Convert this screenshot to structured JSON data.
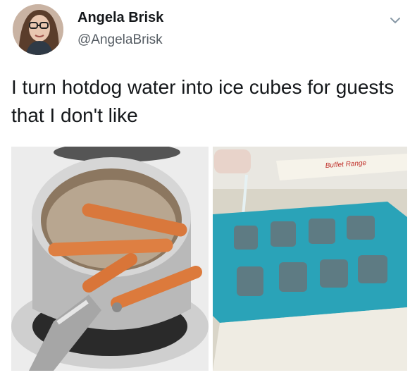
{
  "tweet": {
    "display_name": "Angela Brisk",
    "handle": "@AngelaBrisk",
    "text": "I turn hotdog water into ice cubes for guests that I don't like"
  },
  "media": {
    "left_photo": {
      "subject": "pot of boiling hot dogs"
    },
    "right_photo": {
      "subject": "water poured into blue ice cube tray",
      "label_text": "Buffet Range"
    }
  },
  "icons": {
    "menu": "chevron-down-icon"
  },
  "colors": {
    "text": "#14171a",
    "secondary": "#555c63",
    "tray": "#2aa3b8"
  }
}
